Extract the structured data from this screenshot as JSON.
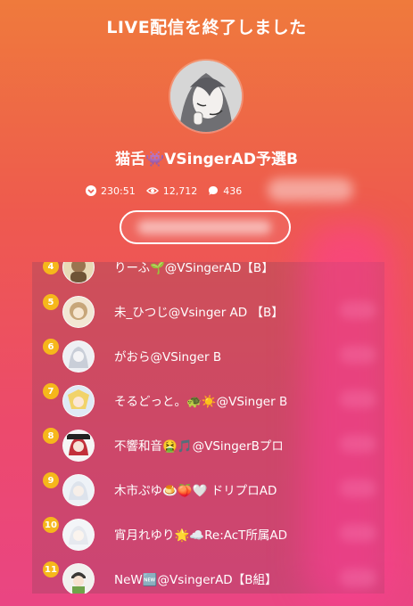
{
  "header": {
    "title": "LIVE配信を終了しました"
  },
  "streamer": {
    "name": "猫舌👾VSingerAD予選B"
  },
  "stats": {
    "duration": "230:51",
    "views": "12,712",
    "comments": "436"
  },
  "colors": {
    "rank_badge": "#f6b71b",
    "bg_top": "#ef7a3c",
    "bg_bottom": "#ea4583"
  },
  "ranking": [
    {
      "rank": "4",
      "name": "りーふ🌱@VSingerAD【B】"
    },
    {
      "rank": "5",
      "name": "未_ひつじ@Vsinger AD 【B】"
    },
    {
      "rank": "6",
      "name": "がおら@VSinger B"
    },
    {
      "rank": "7",
      "name": "そるどっと。🐢☀️@VSinger B"
    },
    {
      "rank": "8",
      "name": "不響和音🤮🎵@VSingerBプロ"
    },
    {
      "rank": "9",
      "name": "木市ぷゆ🍮🍑🤍 ドリプロAD"
    },
    {
      "rank": "10",
      "name": "宵月れゆり🌟☁️Re:AcT所属AD"
    },
    {
      "rank": "11",
      "name": "NeW🆕@VsingerAD【B組】"
    }
  ]
}
